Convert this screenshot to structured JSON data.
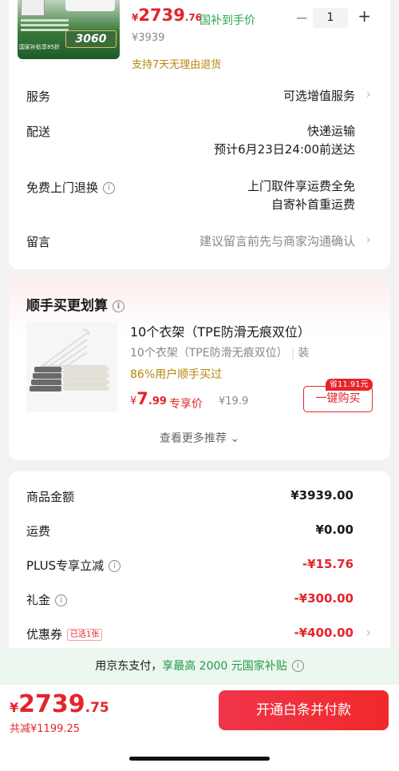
{
  "product": {
    "image_promo_text": "国家补贴享85折",
    "image_badge": "3060",
    "price_symbol": "¥",
    "price_int": "2739",
    "price_dec": ".76",
    "subsidy_label": "国补到手价",
    "original_price": "¥3939",
    "return_policy": "支持7天无理由退货",
    "quantity": "1",
    "minus": "−",
    "plus": "+"
  },
  "order_rows": [
    {
      "label": "服务",
      "value": "可选增值服务",
      "chevron": true
    },
    {
      "label": "配送",
      "value_lines": [
        "快递运输",
        "预计6月23日24:00前送达"
      ]
    },
    {
      "label": "免费上门退换",
      "value_lines": [
        "上门取件享运费全免",
        "自寄补首重运费"
      ],
      "info": true
    },
    {
      "label": "留言",
      "value": "建议留言前先与商家沟通确认",
      "chevron": true
    }
  ],
  "recommend": {
    "title": "顺手买更划算",
    "item_name": "10个衣架（TPE防滑无痕双位）",
    "item_sub": "10个衣架（TPE防滑无痕双位）",
    "item_sub_suffix": "装",
    "item_pct": "86%用户顺手买过",
    "price_symbol": "¥",
    "price_int": "7",
    "price_dec": ".99",
    "exclusive": "专享价",
    "original": "¥19.9",
    "save_tag": "省11.91元",
    "buy_label": "一键购买",
    "more_label": "查看更多推荐 ⌄"
  },
  "summary": [
    {
      "label": "商品金额",
      "value": "¥3939.00",
      "color": "#1a1a1a"
    },
    {
      "label": "运费",
      "value": "¥0.00",
      "color": "#1a1a1a"
    },
    {
      "label": "PLUS专享立减",
      "value": "-¥15.76",
      "color": "#e4242b",
      "info": true
    },
    {
      "label": "礼金",
      "value": "-¥300.00",
      "color": "#e4242b",
      "info": true
    },
    {
      "label": "优惠券",
      "value": "-¥400.00",
      "color": "#e4242b",
      "tag": "已选1张",
      "chevron": true
    }
  ],
  "pay_banner": {
    "prefix": "用京东支付，",
    "highlight": "享最高 2000 元国家补贴"
  },
  "footer": {
    "currency": "¥",
    "total_int": "2739",
    "total_dec": ".75",
    "discount": "共减¥1199.25",
    "pay_button": "开通白条并付款"
  },
  "colors": {
    "accent": "#e4242b",
    "green": "#1f9a45",
    "gold": "#b8860b"
  },
  "icons": {
    "chevron": "chevron-right-icon",
    "info": "info-circle-icon"
  }
}
